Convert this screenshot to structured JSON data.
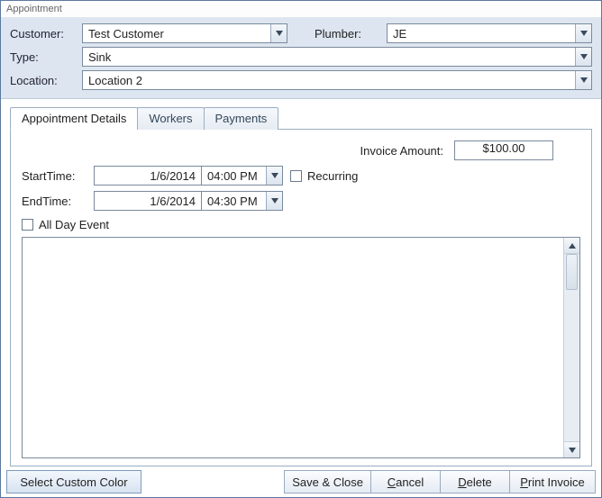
{
  "window": {
    "title": "Appointment"
  },
  "header": {
    "customer_label": "Customer:",
    "customer_value": "Test Customer",
    "plumber_label": "Plumber:",
    "plumber_value": "JE",
    "type_label": "Type:",
    "type_value": "Sink",
    "location_label": "Location:",
    "location_value": "Location 2"
  },
  "tabs": {
    "details": "Appointment Details",
    "workers": "Workers",
    "payments": "Payments"
  },
  "details": {
    "invoice_label": "Invoice Amount:",
    "invoice_value": "$100.00",
    "start_label": "StartTime:",
    "start_date": "1/6/2014",
    "start_time": "04:00 PM",
    "end_label": "EndTime:",
    "end_date": "1/6/2014",
    "end_time": "04:30 PM",
    "recurring_label": "Recurring",
    "allday_label": "All Day Event",
    "notes": ""
  },
  "footer": {
    "color": "Select Custom Color",
    "save": "Save & Close",
    "cancel": "ancel",
    "cancel_m": "C",
    "delete": "elete",
    "delete_m": "D",
    "print": "rint Invoice",
    "print_m": "P"
  }
}
